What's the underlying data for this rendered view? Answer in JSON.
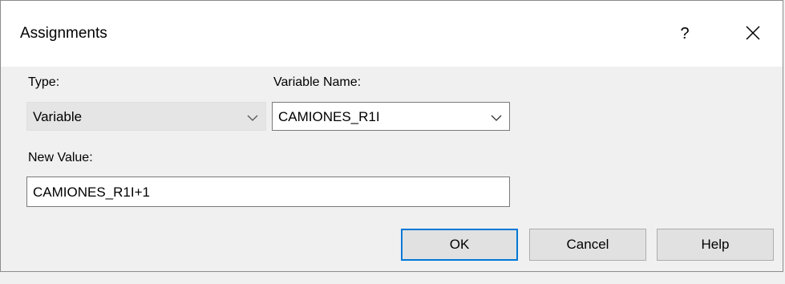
{
  "dialog": {
    "title": "Assignments",
    "help_glyph": "?",
    "close_icon": "close-icon"
  },
  "form": {
    "type_label": "Type:",
    "type_value": "Variable",
    "variable_name_label": "Variable Name:",
    "variable_name_value": "CAMIONES_R1I",
    "new_value_label": "New Value:",
    "new_value_value": "CAMIONES_R1I+1"
  },
  "buttons": {
    "ok": "OK",
    "cancel": "Cancel",
    "help": "Help"
  },
  "colors": {
    "default_button_border": "#0078d7",
    "dialog_background": "#f0f0f0",
    "title_background": "#ffffff"
  }
}
